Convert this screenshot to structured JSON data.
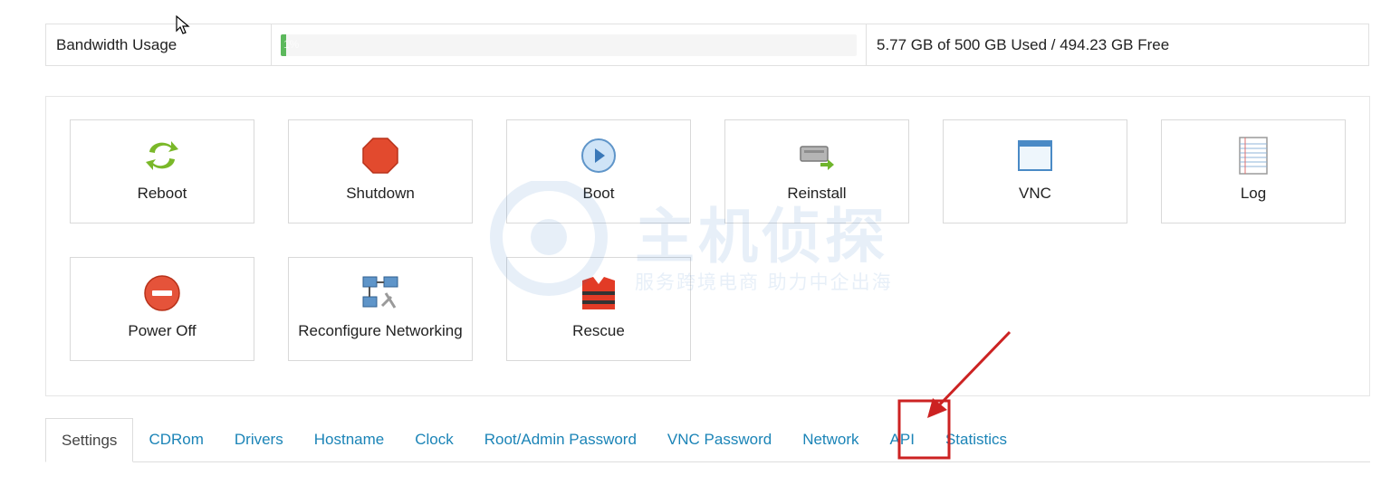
{
  "bandwidth": {
    "label": "Bandwidth Usage",
    "percent": 1,
    "percent_label": "1%",
    "summary": "5.77 GB of 500 GB Used / 494.23 GB Free",
    "fill_color": "#5cb85c"
  },
  "actions": [
    {
      "label": "Reboot",
      "icon": "reboot-icon"
    },
    {
      "label": "Shutdown",
      "icon": "shutdown-icon"
    },
    {
      "label": "Boot",
      "icon": "boot-icon"
    },
    {
      "label": "Reinstall",
      "icon": "reinstall-icon"
    },
    {
      "label": "VNC",
      "icon": "vnc-icon"
    },
    {
      "label": "Log",
      "icon": "log-icon"
    },
    {
      "label": "Power Off",
      "icon": "power-off-icon"
    },
    {
      "label": "Reconfigure Networking",
      "icon": "network-icon"
    },
    {
      "label": "Rescue",
      "icon": "rescue-icon"
    }
  ],
  "watermark": {
    "title": "主机侦探",
    "subtitle": "服务跨境电商 助力中企出海"
  },
  "tabs": [
    {
      "label": "Settings",
      "active": true
    },
    {
      "label": "CDRom"
    },
    {
      "label": "Drivers"
    },
    {
      "label": "Hostname"
    },
    {
      "label": "Clock"
    },
    {
      "label": "Root/Admin Password"
    },
    {
      "label": "VNC Password"
    },
    {
      "label": "Network"
    },
    {
      "label": "API",
      "highlighted": true
    },
    {
      "label": "Statistics"
    }
  ],
  "colors": {
    "link": "#1b84b7",
    "annotation": "#cc2222"
  }
}
